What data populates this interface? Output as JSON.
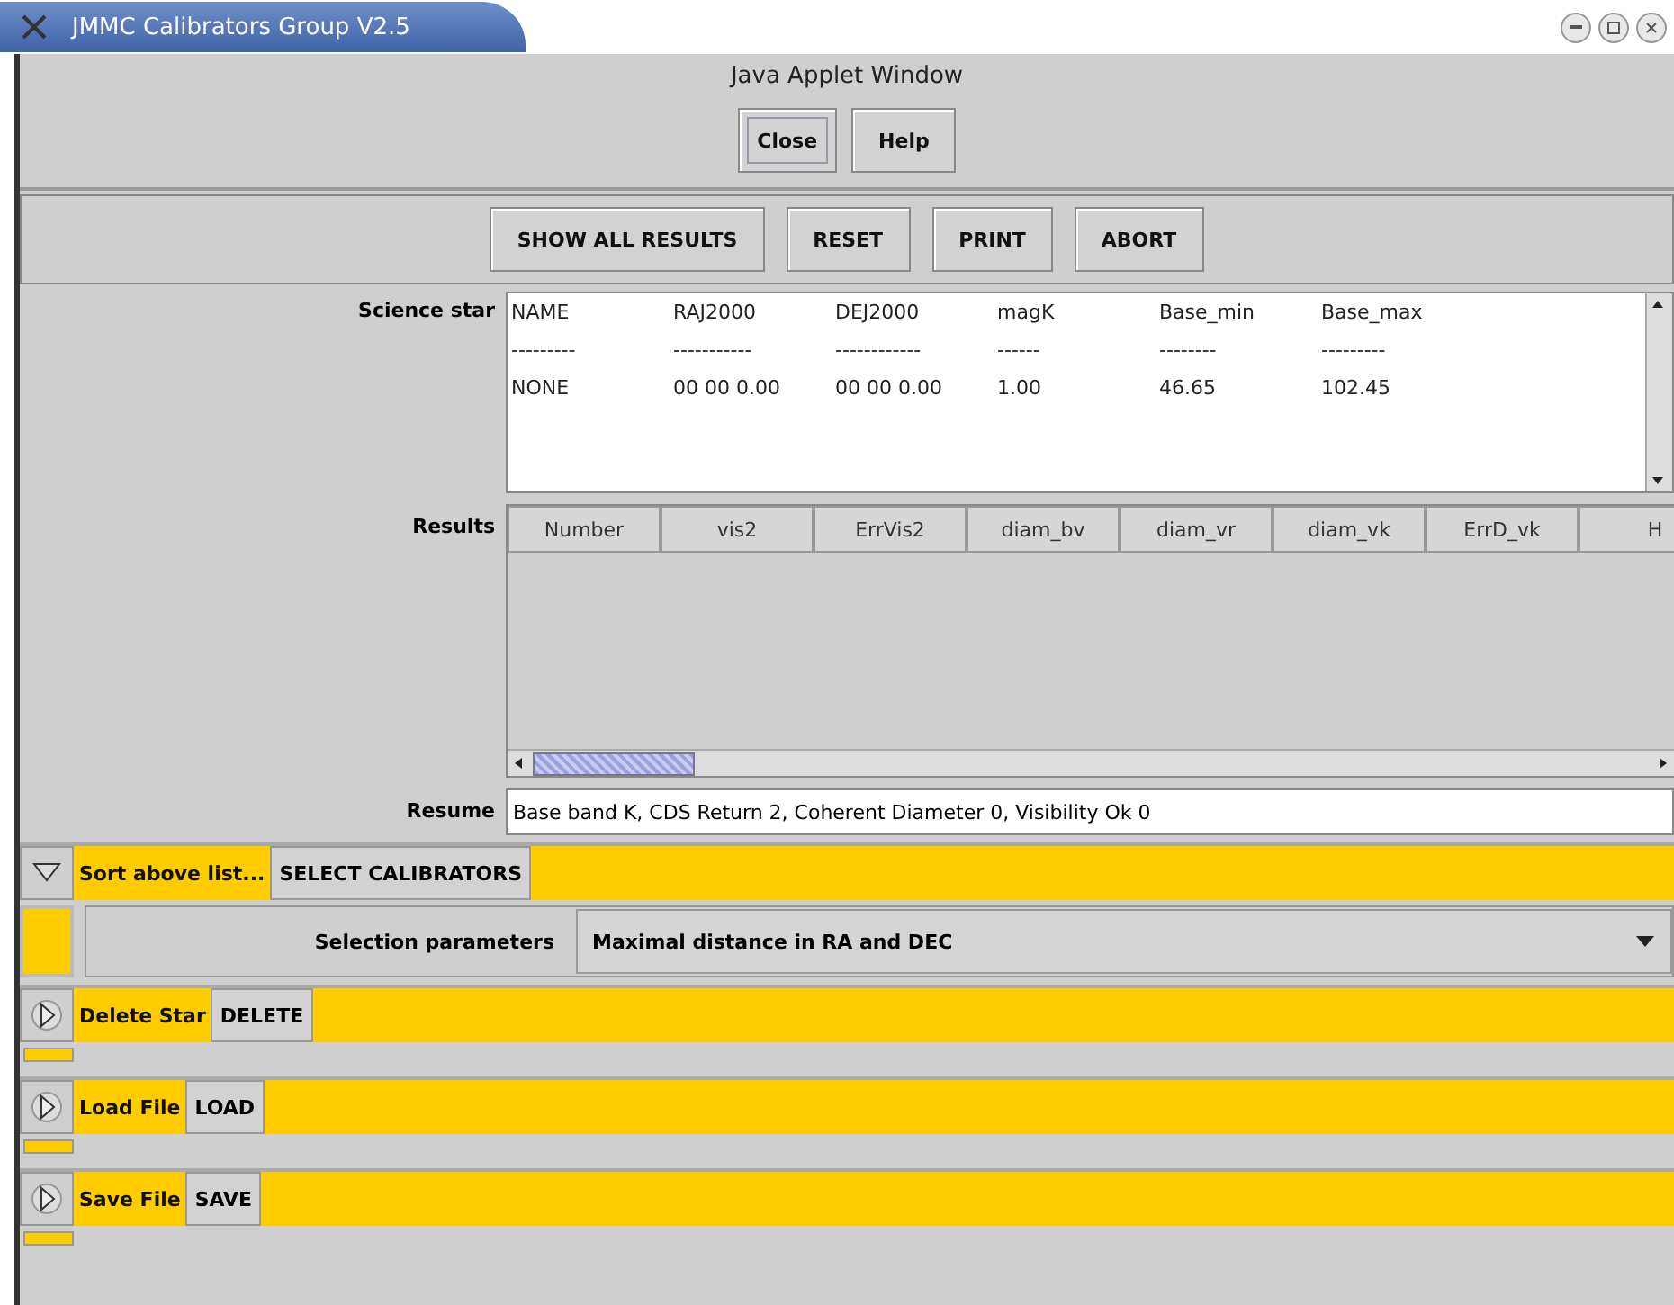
{
  "window": {
    "title": "JMMC Calibrators Group V2.5"
  },
  "applet_label": "Java Applet Window",
  "top_buttons": [
    {
      "label": "Close",
      "focused": true
    },
    {
      "label": "Help",
      "focused": false
    }
  ],
  "toolbar": [
    "SHOW ALL RESULTS",
    "RESET",
    "PRINT",
    "ABORT"
  ],
  "science_star": {
    "label": "Science star",
    "rows": [
      [
        "NAME",
        "RAJ2000",
        "DEJ2000",
        "magK",
        "Base_min",
        "Base_max"
      ],
      [
        "---------",
        "-----------",
        "------------",
        "------",
        "--------",
        "---------"
      ],
      [
        "NONE",
        "00 00 0.00",
        "00 00 0.00",
        "1.00",
        "46.65",
        "102.45"
      ]
    ]
  },
  "results": {
    "label": "Results",
    "columns": [
      "Number",
      "vis2",
      "ErrVis2",
      "diam_bv",
      "diam_vr",
      "diam_vk",
      "ErrD_vk",
      "H"
    ]
  },
  "resume": {
    "label": "Resume",
    "value": "Base band K,  CDS Return 2, Coherent Diameter 0, Visibility Ok 0"
  },
  "panels": [
    {
      "label": "Sort above list...",
      "button": "SELECT CALIBRATORS",
      "expanded": true,
      "field_label": "Selection parameters",
      "field_value": "Maximal distance in RA and DEC"
    },
    {
      "label": "Delete Star",
      "button": "DELETE",
      "expanded": false
    },
    {
      "label": "Load File",
      "button": "LOAD",
      "expanded": false
    },
    {
      "label": "Save File",
      "button": "SAVE",
      "expanded": false
    }
  ]
}
